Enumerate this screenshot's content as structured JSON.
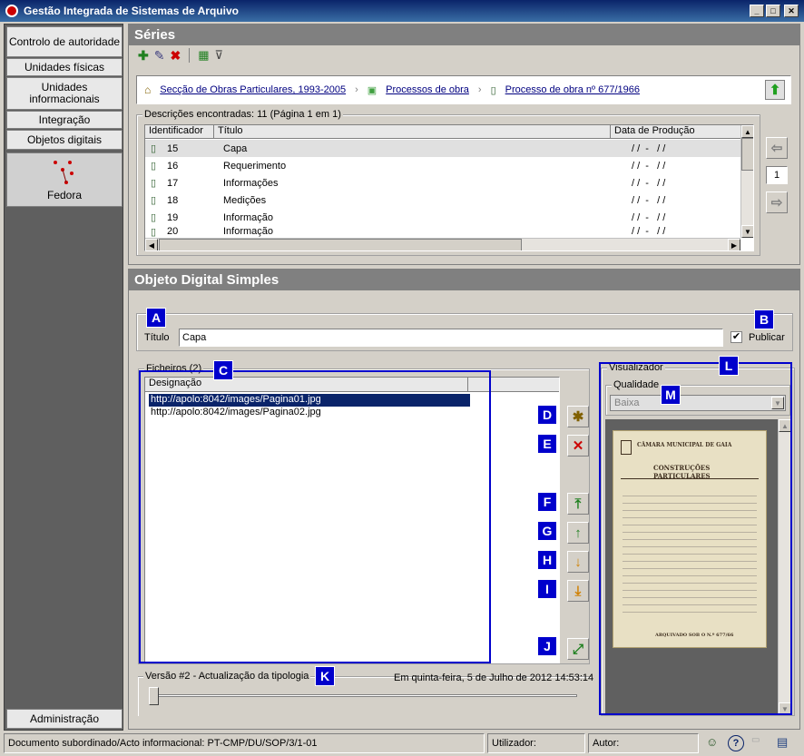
{
  "window": {
    "title": "Gestão Integrada de Sistemas de Arquivo",
    "min": "_",
    "max": "□",
    "close": "✕"
  },
  "sidebar": {
    "items": [
      {
        "label": "Controlo de autoridade"
      },
      {
        "label": "Unidades físicas"
      },
      {
        "label": "Unidades informacionais"
      },
      {
        "label": "Integração"
      },
      {
        "label": "Objetos digitais"
      }
    ],
    "fedora": "Fedora",
    "admin": "Administração"
  },
  "series": {
    "header": "Séries",
    "breadcrumb": [
      "Secção de Obras Particulares, 1993-2005",
      "Processos de obra",
      "Processo de obra nº 677/1966"
    ],
    "found": "Descrições encontradas: 11 (Página 1 em 1)",
    "columns": [
      "Identificador",
      "Título",
      "Data de Produção"
    ],
    "rows": [
      {
        "id": "15",
        "title": "Capa",
        "date": "/ /  -   / /"
      },
      {
        "id": "16",
        "title": "Requerimento",
        "date": "/ /  -   / /"
      },
      {
        "id": "17",
        "title": "Informações",
        "date": "/ /  -   / /"
      },
      {
        "id": "18",
        "title": "Medições",
        "date": "/ /  -   / /"
      },
      {
        "id": "19",
        "title": "Informação",
        "date": "/ /  -   / /"
      },
      {
        "id": "20",
        "title": "Informação",
        "date": "/ /  -   / /"
      }
    ],
    "page": "1"
  },
  "object": {
    "header": "Objeto Digital Simples",
    "title_label": "Título",
    "title_value": "Capa",
    "publish_label": "Publicar",
    "publish_checked": true,
    "files_legend": "Ficheiros (2)",
    "files_column": "Designação",
    "files": [
      "http://apolo:8042/images/Pagina01.jpg",
      "http://apolo:8042/images/Pagina02.jpg"
    ],
    "viewer_legend": "Visualizador",
    "quality_legend": "Qualidade",
    "quality_value": "Baixa",
    "version_legend": "Versão #2 - Actualização da tipologia",
    "version_date": "Em quinta-feira, 5 de Julho de 2012 14:53:14",
    "doc_heading1": "CÂMARA MUNICIPAL DE GAIA",
    "doc_heading2": "CONSTRUÇÕES PARTICULARES",
    "doc_footer": "ARQUIVADO SOB O N.º 677/66"
  },
  "labels": [
    "A",
    "B",
    "C",
    "D",
    "E",
    "F",
    "G",
    "H",
    "I",
    "J",
    "K",
    "L",
    "M"
  ],
  "status": {
    "document": "Documento subordinado/Acto informacional: PT-CMP/DU/SOP/3/1-01",
    "user": "Utilizador:",
    "author": "Autor:"
  }
}
